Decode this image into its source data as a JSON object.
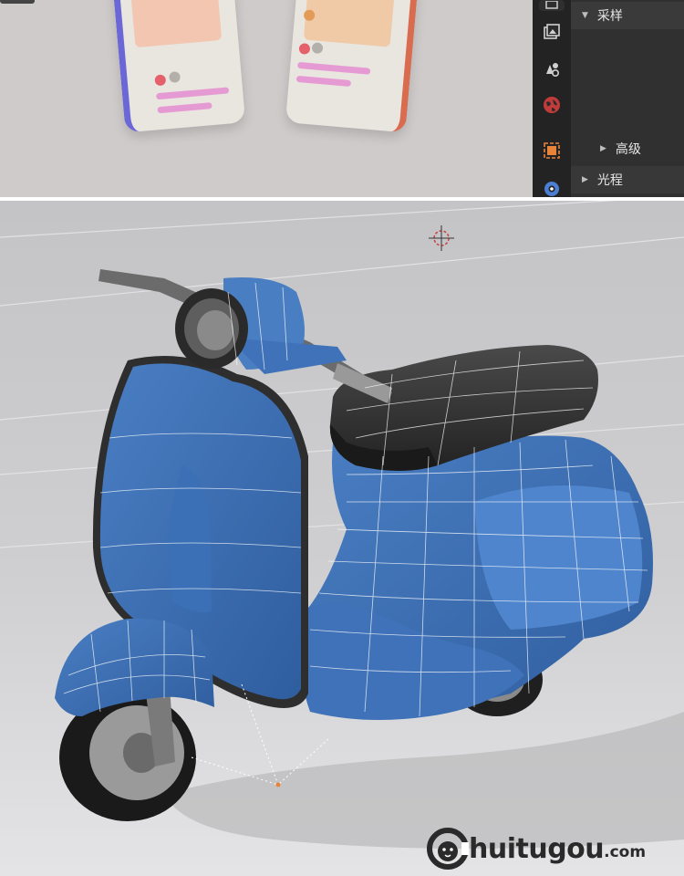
{
  "properties_panel": {
    "sections": [
      {
        "label": "采样",
        "expanded": true
      },
      {
        "label": "高级",
        "expanded": false,
        "nested": true
      },
      {
        "label": "光程",
        "expanded": false
      }
    ],
    "tabs": [
      "texture-icon",
      "output-icon",
      "view-layer-icon",
      "scene-icon",
      "world-icon",
      "object-icon",
      "modifier-icon"
    ]
  },
  "top_viewport": {
    "content": "phone-mockups"
  },
  "main_viewport": {
    "subject": "scooter-wireframe-model",
    "colors": {
      "body": "#3d6fb3",
      "seat": "#2f2f2f",
      "wire": "#ffffff",
      "floor": "#d6d6d6"
    }
  },
  "watermark": {
    "brand_letter": "C",
    "text": "huitugou",
    "tld": ".com"
  }
}
